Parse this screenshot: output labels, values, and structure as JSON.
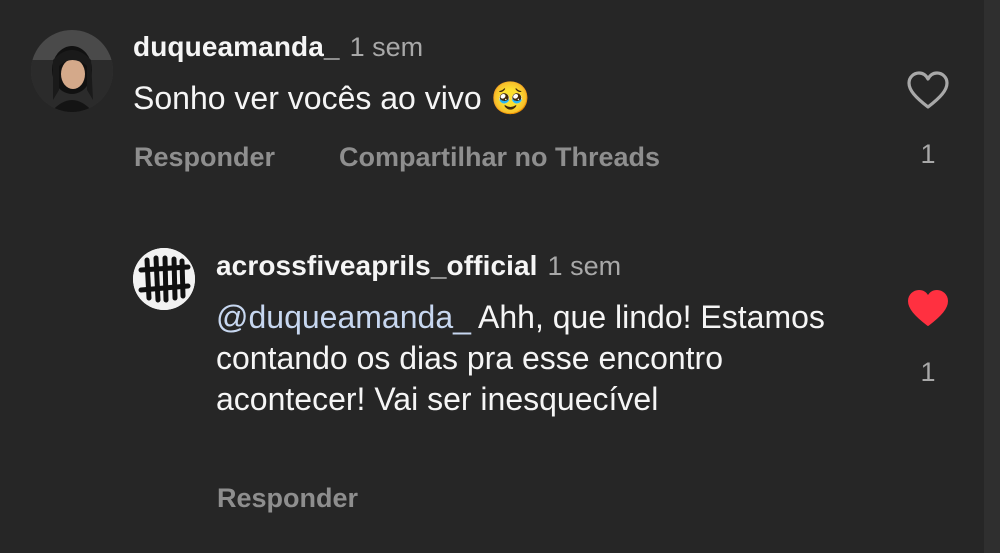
{
  "comment": {
    "username": "duqueamanda_",
    "time": "1 sem",
    "text": "Sonho ver vocês ao vivo",
    "emoji": "🥹",
    "reply_label": "Responder",
    "share_label": "Compartilhar no Threads",
    "likes": "1",
    "liked": false
  },
  "reply": {
    "username": "acrossfiveaprils_official",
    "time": "1 sem",
    "mention": "@duqueamanda_",
    "text": " Ahh, que lindo! Estamos contando os dias pra esse encontro acontecer! Vai ser inesquecível",
    "reply_label": "Responder",
    "likes": "1",
    "liked": true
  },
  "colors": {
    "background": "#262626",
    "like_active": "#ff3040",
    "muted": "#a8a8a8"
  }
}
